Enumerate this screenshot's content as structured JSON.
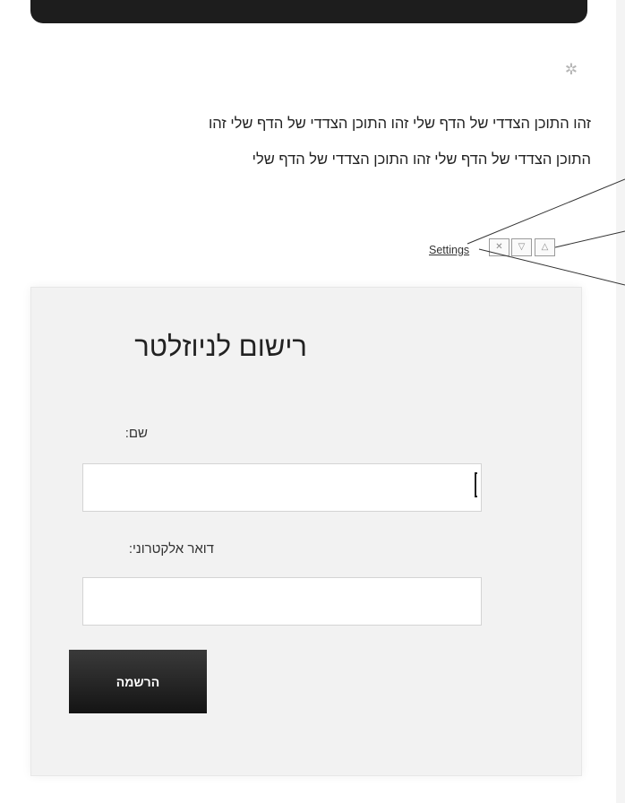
{
  "sidebar_widget": {
    "gear_icon": "gear-icon",
    "text_line_1": "זהו התוכן הצדדי של הדף שלי זהו התוכן הצדדי של הדף שלי זהו",
    "text_line_2": "התוכן הצדדי של הדף שלי זהו התוכן הצדדי של הדף שלי",
    "settings_label": "Settings",
    "controls": {
      "close_icon": "close-icon",
      "collapse_icon": "chevron-down-icon",
      "expand_icon": "chevron-up-icon"
    }
  },
  "newsletter": {
    "title": "רישום לניוזלטר",
    "name_label": "שם:",
    "name_value": "",
    "email_label": "דואר אלקטרוני:",
    "email_value": "",
    "submit_label": "הרשמה"
  },
  "colors": {
    "top_bar": "#1d1d1d",
    "panel_background": "#f2f2f2",
    "button_background": "#1f1f1f"
  }
}
